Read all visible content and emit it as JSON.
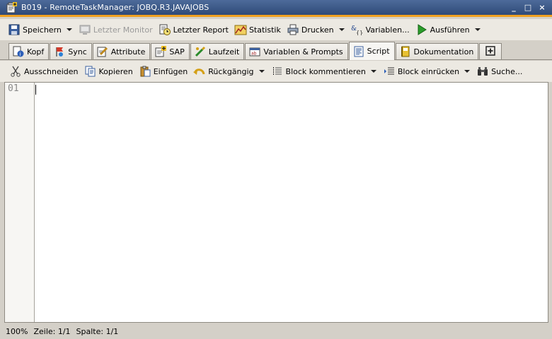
{
  "window": {
    "title": "B019 - RemoteTaskManager: JOBQ.R3.JAVAJOBS",
    "minimize": "_",
    "maximize": "□",
    "close": "×"
  },
  "toolbar": {
    "save": "Speichern",
    "last_monitor": "Letzter Monitor",
    "last_report": "Letzter Report",
    "statistics": "Statistik",
    "print": "Drucken",
    "variables": "Variablen...",
    "execute": "Ausführen"
  },
  "tabs": [
    {
      "label": "Kopf"
    },
    {
      "label": "Sync"
    },
    {
      "label": "Attribute"
    },
    {
      "label": "SAP"
    },
    {
      "label": "Laufzeit"
    },
    {
      "label": "Variablen & Prompts"
    },
    {
      "label": "Script"
    },
    {
      "label": "Dokumentation"
    }
  ],
  "active_tab": "Script",
  "editor_toolbar": {
    "cut": "Ausschneiden",
    "copy": "Kopieren",
    "paste": "Einfügen",
    "undo": "Rückgängig",
    "comment_block": "Block kommentieren",
    "indent_block": "Block einrücken",
    "search": "Suche..."
  },
  "editor": {
    "line_numbers": [
      "01"
    ],
    "content": ""
  },
  "status": {
    "zoom": "100%",
    "line": "Zeile: 1/1",
    "column": "Spalte: 1/1"
  },
  "colors": {
    "title_bar": "#3c5885",
    "title_accent": "#f0a020",
    "chrome": "#d4d0c8",
    "toolbar": "#ece9e2",
    "execute_green": "#2a9d2a"
  }
}
